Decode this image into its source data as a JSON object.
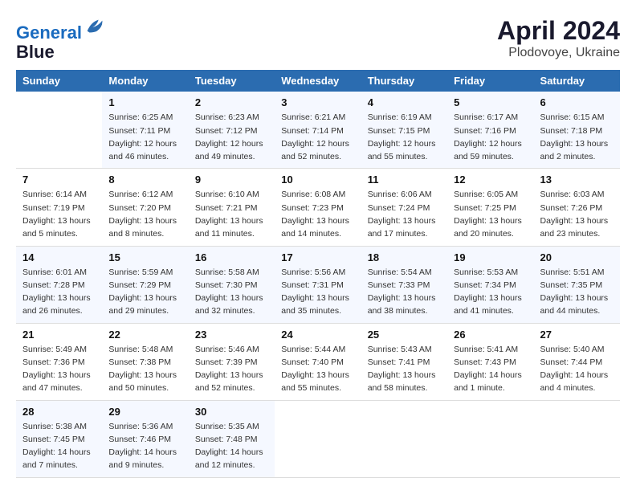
{
  "logo": {
    "line1": "General",
    "line2": "Blue"
  },
  "title": "April 2024",
  "subtitle": "Plodovoye, Ukraine",
  "days_of_week": [
    "Sunday",
    "Monday",
    "Tuesday",
    "Wednesday",
    "Thursday",
    "Friday",
    "Saturday"
  ],
  "weeks": [
    [
      {
        "num": "",
        "info": ""
      },
      {
        "num": "1",
        "info": "Sunrise: 6:25 AM\nSunset: 7:11 PM\nDaylight: 12 hours\nand 46 minutes."
      },
      {
        "num": "2",
        "info": "Sunrise: 6:23 AM\nSunset: 7:12 PM\nDaylight: 12 hours\nand 49 minutes."
      },
      {
        "num": "3",
        "info": "Sunrise: 6:21 AM\nSunset: 7:14 PM\nDaylight: 12 hours\nand 52 minutes."
      },
      {
        "num": "4",
        "info": "Sunrise: 6:19 AM\nSunset: 7:15 PM\nDaylight: 12 hours\nand 55 minutes."
      },
      {
        "num": "5",
        "info": "Sunrise: 6:17 AM\nSunset: 7:16 PM\nDaylight: 12 hours\nand 59 minutes."
      },
      {
        "num": "6",
        "info": "Sunrise: 6:15 AM\nSunset: 7:18 PM\nDaylight: 13 hours\nand 2 minutes."
      }
    ],
    [
      {
        "num": "7",
        "info": "Sunrise: 6:14 AM\nSunset: 7:19 PM\nDaylight: 13 hours\nand 5 minutes."
      },
      {
        "num": "8",
        "info": "Sunrise: 6:12 AM\nSunset: 7:20 PM\nDaylight: 13 hours\nand 8 minutes."
      },
      {
        "num": "9",
        "info": "Sunrise: 6:10 AM\nSunset: 7:21 PM\nDaylight: 13 hours\nand 11 minutes."
      },
      {
        "num": "10",
        "info": "Sunrise: 6:08 AM\nSunset: 7:23 PM\nDaylight: 13 hours\nand 14 minutes."
      },
      {
        "num": "11",
        "info": "Sunrise: 6:06 AM\nSunset: 7:24 PM\nDaylight: 13 hours\nand 17 minutes."
      },
      {
        "num": "12",
        "info": "Sunrise: 6:05 AM\nSunset: 7:25 PM\nDaylight: 13 hours\nand 20 minutes."
      },
      {
        "num": "13",
        "info": "Sunrise: 6:03 AM\nSunset: 7:26 PM\nDaylight: 13 hours\nand 23 minutes."
      }
    ],
    [
      {
        "num": "14",
        "info": "Sunrise: 6:01 AM\nSunset: 7:28 PM\nDaylight: 13 hours\nand 26 minutes."
      },
      {
        "num": "15",
        "info": "Sunrise: 5:59 AM\nSunset: 7:29 PM\nDaylight: 13 hours\nand 29 minutes."
      },
      {
        "num": "16",
        "info": "Sunrise: 5:58 AM\nSunset: 7:30 PM\nDaylight: 13 hours\nand 32 minutes."
      },
      {
        "num": "17",
        "info": "Sunrise: 5:56 AM\nSunset: 7:31 PM\nDaylight: 13 hours\nand 35 minutes."
      },
      {
        "num": "18",
        "info": "Sunrise: 5:54 AM\nSunset: 7:33 PM\nDaylight: 13 hours\nand 38 minutes."
      },
      {
        "num": "19",
        "info": "Sunrise: 5:53 AM\nSunset: 7:34 PM\nDaylight: 13 hours\nand 41 minutes."
      },
      {
        "num": "20",
        "info": "Sunrise: 5:51 AM\nSunset: 7:35 PM\nDaylight: 13 hours\nand 44 minutes."
      }
    ],
    [
      {
        "num": "21",
        "info": "Sunrise: 5:49 AM\nSunset: 7:36 PM\nDaylight: 13 hours\nand 47 minutes."
      },
      {
        "num": "22",
        "info": "Sunrise: 5:48 AM\nSunset: 7:38 PM\nDaylight: 13 hours\nand 50 minutes."
      },
      {
        "num": "23",
        "info": "Sunrise: 5:46 AM\nSunset: 7:39 PM\nDaylight: 13 hours\nand 52 minutes."
      },
      {
        "num": "24",
        "info": "Sunrise: 5:44 AM\nSunset: 7:40 PM\nDaylight: 13 hours\nand 55 minutes."
      },
      {
        "num": "25",
        "info": "Sunrise: 5:43 AM\nSunset: 7:41 PM\nDaylight: 13 hours\nand 58 minutes."
      },
      {
        "num": "26",
        "info": "Sunrise: 5:41 AM\nSunset: 7:43 PM\nDaylight: 14 hours\nand 1 minute."
      },
      {
        "num": "27",
        "info": "Sunrise: 5:40 AM\nSunset: 7:44 PM\nDaylight: 14 hours\nand 4 minutes."
      }
    ],
    [
      {
        "num": "28",
        "info": "Sunrise: 5:38 AM\nSunset: 7:45 PM\nDaylight: 14 hours\nand 7 minutes."
      },
      {
        "num": "29",
        "info": "Sunrise: 5:36 AM\nSunset: 7:46 PM\nDaylight: 14 hours\nand 9 minutes."
      },
      {
        "num": "30",
        "info": "Sunrise: 5:35 AM\nSunset: 7:48 PM\nDaylight: 14 hours\nand 12 minutes."
      },
      {
        "num": "",
        "info": ""
      },
      {
        "num": "",
        "info": ""
      },
      {
        "num": "",
        "info": ""
      },
      {
        "num": "",
        "info": ""
      }
    ]
  ]
}
